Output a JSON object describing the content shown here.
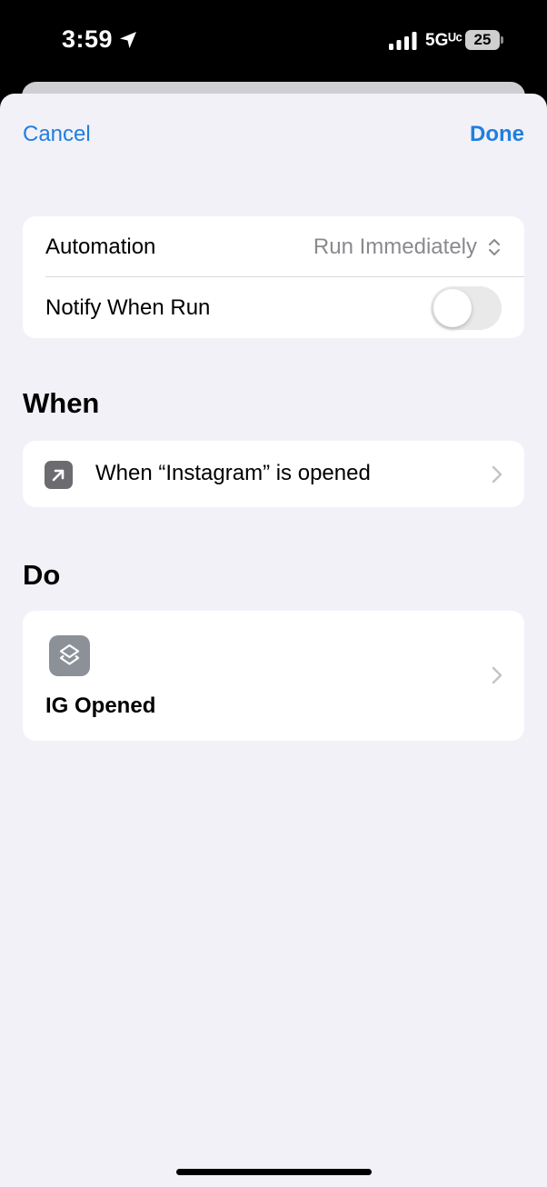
{
  "status_bar": {
    "time": "3:59",
    "network": "5Gᵁᶜ",
    "battery": "25",
    "location_icon": "location-arrow-icon",
    "signal_icon": "signal-bars-icon"
  },
  "nav": {
    "cancel_label": "Cancel",
    "done_label": "Done",
    "accent_color": "#1f7fe0"
  },
  "settings": {
    "automation_label": "Automation",
    "automation_value": "Run Immediately",
    "automation_icon": "chevron-up-down-icon",
    "notify_label": "Notify When Run",
    "notify_enabled": false
  },
  "when": {
    "header": "When",
    "trigger_text": "When “Instagram” is opened",
    "trigger_icon": "app-open-arrow-icon"
  },
  "do": {
    "header": "Do",
    "action_name": "IG Opened",
    "action_icon": "shortcuts-layers-icon"
  }
}
